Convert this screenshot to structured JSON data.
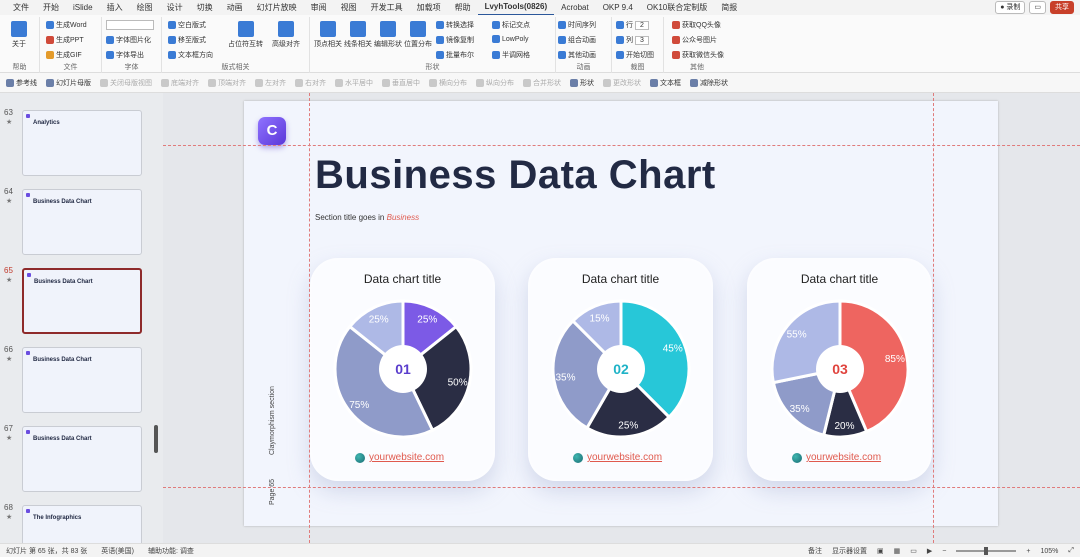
{
  "menu": {
    "tabs": [
      "文件",
      "开始",
      "iSlide",
      "插入",
      "绘图",
      "设计",
      "切换",
      "动画",
      "幻灯片放映",
      "审阅",
      "视图",
      "开发工具",
      "加载项",
      "帮助",
      "LvyhTools(0826)",
      "Acrobat",
      "OKP 9.4",
      "OK10联合定制版",
      "简报"
    ],
    "active_tab": "LvyhTools(0826)",
    "record_label": "录制",
    "comment_label": "",
    "share_label": "共享"
  },
  "ribbon": {
    "groups": [
      {
        "label": "帮助",
        "items": [
          "关于"
        ]
      },
      {
        "label": "文件",
        "items": [
          "生成Word",
          "生成PPT",
          "生成GIF"
        ]
      },
      {
        "label": "字体",
        "items": [
          "字体图片化",
          "字体导出"
        ]
      },
      {
        "label": "版式相关",
        "items": [
          "空白版式",
          "移至版式",
          "文本框方向",
          "占位符互转",
          "高级对齐"
        ]
      },
      {
        "label": "形状",
        "items": [
          "顶点相关",
          "线条相关",
          "编辑形状",
          "位置分布",
          "转换选择",
          "镜像复制",
          "批量布尔",
          "标记交点",
          "LowPoly",
          "半调网格"
        ]
      },
      {
        "label": "动画",
        "items": [
          "时间序列",
          "组合动画",
          "其他动画"
        ]
      },
      {
        "label": "裁图",
        "items": [
          "行",
          "列",
          "开始切图"
        ]
      },
      {
        "label": "其他",
        "items": [
          "获取QQ头像",
          "公众号图片",
          "获取微信头像"
        ]
      }
    ],
    "row_value": "2",
    "col_value": "3"
  },
  "toolbar": {
    "items": [
      {
        "label": "参考线",
        "enabled": true
      },
      {
        "label": "幻灯片母版",
        "enabled": true
      },
      {
        "label": "关闭母版视图",
        "enabled": false
      },
      {
        "label": "底端对齐",
        "enabled": false
      },
      {
        "label": "顶端对齐",
        "enabled": false
      },
      {
        "label": "左对齐",
        "enabled": false
      },
      {
        "label": "右对齐",
        "enabled": false
      },
      {
        "label": "水平居中",
        "enabled": false
      },
      {
        "label": "垂直居中",
        "enabled": false
      },
      {
        "label": "横向分布",
        "enabled": false
      },
      {
        "label": "纵向分布",
        "enabled": false
      },
      {
        "label": "合并形状",
        "enabled": false
      },
      {
        "label": "形状",
        "enabled": true
      },
      {
        "label": "更改形状",
        "enabled": false
      },
      {
        "label": "文本框",
        "enabled": true
      },
      {
        "label": "减除形状",
        "enabled": true
      }
    ]
  },
  "thumbnails": [
    {
      "num": "63",
      "title": "Analytics"
    },
    {
      "num": "64",
      "title": "Business Data Chart"
    },
    {
      "num": "65",
      "title": "Business Data Chart",
      "active": true
    },
    {
      "num": "66",
      "title": "Business Data Chart"
    },
    {
      "num": "67",
      "title": "Business Data Chart"
    },
    {
      "num": "68",
      "title": "The Infographics"
    }
  ],
  "slide": {
    "logo": "C",
    "title": "Business Data Chart",
    "subtitle_prefix": "Section title goes in",
    "subtitle_emph": "Business",
    "side_label": "Claymorphism section",
    "page_label": "Page 65"
  },
  "chart_data": [
    {
      "type": "pie",
      "title": "Data chart title",
      "center_label": "01",
      "link": "yourwebsite.com",
      "slices": [
        {
          "label": "25%",
          "value": 25,
          "color": "#7c5ae6"
        },
        {
          "label": "50%",
          "value": 50,
          "color": "#2a2d44"
        },
        {
          "label": "75%",
          "value": 75,
          "color": "#8f9bc9"
        },
        {
          "label": "25%",
          "value": 25,
          "color": "#aeb9e6"
        }
      ],
      "center_color": "#5a3dcc"
    },
    {
      "type": "pie",
      "title": "Data chart title",
      "center_label": "02",
      "link": "yourwebsite.com",
      "slices": [
        {
          "label": "45%",
          "value": 45,
          "color": "#27c7d8"
        },
        {
          "label": "25%",
          "value": 25,
          "color": "#2a2d44"
        },
        {
          "label": "35%",
          "value": 35,
          "color": "#8f9bc9"
        },
        {
          "label": "15%",
          "value": 15,
          "color": "#aeb9e6"
        }
      ],
      "center_color": "#1fb3c7"
    },
    {
      "type": "pie",
      "title": "Data chart title",
      "center_label": "03",
      "link": "yourwebsite.com",
      "slices": [
        {
          "label": "85%",
          "value": 85,
          "color": "#ee6560"
        },
        {
          "label": "20%",
          "value": 20,
          "color": "#2a2d44"
        },
        {
          "label": "35%",
          "value": 35,
          "color": "#8f9bc9"
        },
        {
          "label": "55%",
          "value": 55,
          "color": "#aeb9e6"
        }
      ],
      "center_color": "#e0443e"
    }
  ],
  "status": {
    "slide_info": "幻灯片 第 65 张，共 83 张",
    "language": "英语(美国)",
    "accessibility": "辅助功能: 调查",
    "notes": "备注",
    "display_settings": "显示器设置",
    "zoom": "105%"
  }
}
